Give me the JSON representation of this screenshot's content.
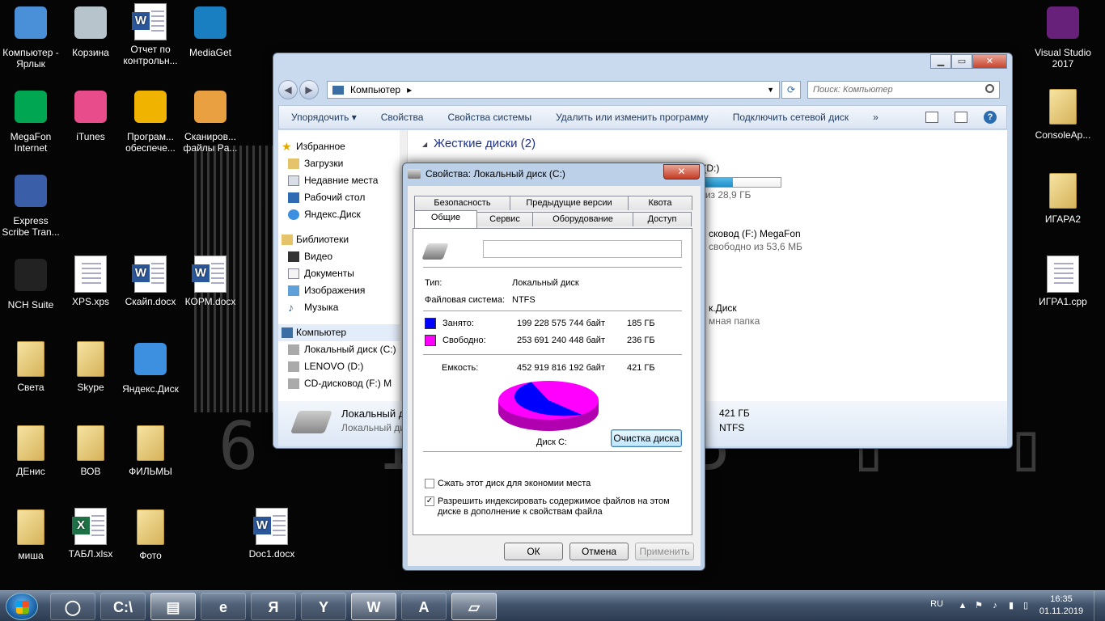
{
  "desktop": {
    "icons": [
      {
        "label": "Компьютер - Ярлык",
        "kind": "computer-icon"
      },
      {
        "label": "Корзина",
        "kind": "recycle-bin-icon"
      },
      {
        "label": "Отчет по контрольн...",
        "kind": "word-doc-icon"
      },
      {
        "label": "MediaGet",
        "kind": "mediaget-icon"
      },
      {
        "label": "MegaFon Internet",
        "kind": "megafon-icon"
      },
      {
        "label": "iTunes",
        "kind": "itunes-icon"
      },
      {
        "label": "Програм... обеспече...",
        "kind": "software-icon"
      },
      {
        "label": "Сканиров... файлы Pa...",
        "kind": "scan-folder-icon"
      },
      {
        "label": "Express Scribe Tran...",
        "kind": "express-scribe-icon"
      },
      {
        "label": "NCH Suite",
        "kind": "nch-icon"
      },
      {
        "label": "XPS.xps",
        "kind": "xps-doc-icon"
      },
      {
        "label": "Скайп.docx",
        "kind": "word-doc-icon"
      },
      {
        "label": "КОРМ.docx",
        "kind": "word-doc-icon"
      },
      {
        "label": "Света",
        "kind": "folder-icon"
      },
      {
        "label": "Skype",
        "kind": "folder-icon"
      },
      {
        "label": "Яндекс.Диск",
        "kind": "yandex-disk-icon"
      },
      {
        "label": "ДЕнис",
        "kind": "folder-icon"
      },
      {
        "label": "ВОВ",
        "kind": "folder-icon"
      },
      {
        "label": "ФИЛЬМЫ",
        "kind": "folder-icon"
      },
      {
        "label": "миша",
        "kind": "folder-icon"
      },
      {
        "label": "ТАБЛ.xlsx",
        "kind": "excel-doc-icon"
      },
      {
        "label": "Фото",
        "kind": "folder-icon"
      },
      {
        "label": "Doc1.docx",
        "kind": "word-doc-icon"
      },
      {
        "label": "Visual Studio 2017",
        "kind": "visual-studio-icon"
      },
      {
        "label": "ConsoleAp...",
        "kind": "folder-icon"
      },
      {
        "label": "ИГАРА2",
        "kind": "folder-icon"
      },
      {
        "label": "ИГРА1.cpp",
        "kind": "cpp-file-icon"
      }
    ],
    "bg_numbers": "6 1 0 5 ▯ ▯ ▯ ▯ 1"
  },
  "explorer": {
    "address": "Компьютер",
    "search_placeholder": "Поиск: Компьютер",
    "toolbar": [
      "Упорядочить ▾",
      "Свойства",
      "Свойства системы",
      "Удалить или изменить программу",
      "Подключить сетевой диск",
      "»"
    ],
    "nav": {
      "favorites": "Избранное",
      "fav_items": [
        "Загрузки",
        "Недавние места",
        "Рабочий стол",
        "Яндекс.Диск"
      ],
      "libraries": "Библиотеки",
      "lib_items": [
        "Видео",
        "Документы",
        "Изображения",
        "Музыка"
      ],
      "computer": "Компьютер",
      "comp_items": [
        "Локальный диск (C:)",
        "LENOVO (D:)",
        "CD-дисковод (F:) M"
      ]
    },
    "group_header": "Жесткие диски (2)",
    "drive_d": {
      "name": "LENOVO (D:)",
      "free_text": "свободно из 28,9 ГБ",
      "fill": 0.6
    },
    "drive_f": {
      "name": "сковод (F:) MegaFon",
      "free_text": "свободно из 53,6 МБ"
    },
    "drive_y": {
      "name": "к.Диск",
      "sub": "мная папка"
    },
    "details": {
      "name": "Локальный д",
      "sub": "Локальный ди",
      "r1": "421 ГБ",
      "r2": "NTFS"
    }
  },
  "dialog": {
    "title": "Свойства: Локальный диск (C:)",
    "tabs_top": [
      "Безопасность",
      "Предыдущие версии",
      "Квота"
    ],
    "tabs_bottom": [
      "Общие",
      "Сервис",
      "Оборудование",
      "Доступ"
    ],
    "name_value": "",
    "type_label": "Тип:",
    "type_value": "Локальный диск",
    "fs_label": "Файловая система:",
    "fs_value": "NTFS",
    "used_label": "Занято:",
    "used_bytes": "199 228 575 744 байт",
    "used_gb": "185 ГБ",
    "free_label": "Свободно:",
    "free_bytes": "253 691 240 448 байт",
    "free_gb": "236 ГБ",
    "cap_label": "Емкость:",
    "cap_bytes": "452 919 816 192 байт",
    "cap_gb": "421 ГБ",
    "disk_label": "Диск C:",
    "cleanup_button": "Очистка диска",
    "compress_label": "Сжать этот диск для экономии места",
    "compress_checked": false,
    "index_label": "Разрешить индексировать содержимое файлов на этом диске в дополнение к свойствам файла",
    "index_checked": true,
    "ok": "ОК",
    "cancel": "Отмена",
    "apply": "Применить",
    "used_color": "#0000ff",
    "free_color": "#ff00ff"
  },
  "taskbar": {
    "items": [
      {
        "name": "alice-button",
        "glyph": "◯",
        "active": false
      },
      {
        "name": "cmd-button",
        "glyph": "C:\\",
        "active": false
      },
      {
        "name": "explorer-button",
        "glyph": "▤",
        "active": true
      },
      {
        "name": "ie-button",
        "glyph": "e",
        "active": false
      },
      {
        "name": "yandex-button",
        "glyph": "Я",
        "active": false
      },
      {
        "name": "yandex-browser-button",
        "glyph": "Y",
        "active": false
      },
      {
        "name": "word-button",
        "glyph": "W",
        "active": true
      },
      {
        "name": "acrobat-button",
        "glyph": "A",
        "active": false
      },
      {
        "name": "drive-tool-button",
        "glyph": "▱",
        "active": true
      }
    ],
    "lang": "RU",
    "time": "16:35",
    "date": "01.11.2019"
  }
}
